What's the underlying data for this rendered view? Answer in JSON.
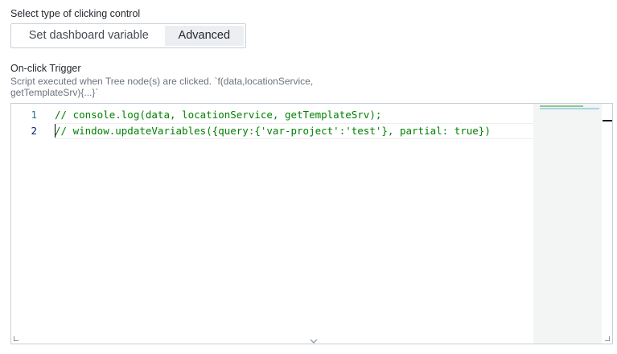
{
  "clicking_control": {
    "label": "Select type of clicking control",
    "options": [
      {
        "label": "Set dashboard variable",
        "selected": false
      },
      {
        "label": "Advanced",
        "selected": true
      }
    ]
  },
  "trigger": {
    "label": "On-click Trigger",
    "description": "Script executed when Tree node(s) are clicked. `f(data,locationService, getTemplateSrv){...}`"
  },
  "editor": {
    "lines": [
      {
        "number": "1",
        "text": "// console.log(data, locationService, getTemplateSrv);"
      },
      {
        "number": "2",
        "text": "// window.updateVariables({query:{'var-project':'test'}, partial: true})"
      }
    ],
    "active_line": 2,
    "comment_color": "#008000",
    "line_number_color": "#237893"
  },
  "icons": {
    "resize_left": "corner-resize-icon",
    "resize_right": "corner-resize-icon",
    "resize_bottom": "chevron-down-icon"
  }
}
